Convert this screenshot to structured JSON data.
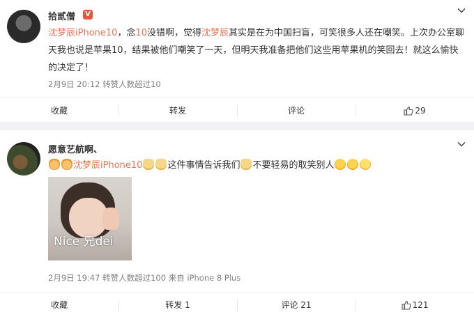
{
  "post1": {
    "username": "拾贰僧",
    "badge": "V",
    "text_parts": [
      {
        "t": "沈梦辰iPhone10",
        "link": true
      },
      {
        "t": "，念",
        "link": false
      },
      {
        "t": "10",
        "link": true
      },
      {
        "t": "没错啊，觉得",
        "link": false
      },
      {
        "t": "沈梦辰",
        "link": true
      },
      {
        "t": "其实是在为中国扫盲，可笑很多人还在嘲笑。上次办公室聊天我也说是苹果10，结果被他们嘲笑了一天，但明天我准备把他们这些用苹果机的笑回去！就这么愉快的决定了！",
        "link": false
      }
    ],
    "time": "2月9日 20:12",
    "stat": "转赞人数超过10",
    "actions": {
      "collect": "收藏",
      "repost": "转发",
      "comment": "评论",
      "like_count": "29"
    }
  },
  "post2": {
    "username": "愿意艺航啊、",
    "mention": "沈梦辰iPhone10",
    "text_a": "这件事情告诉我们",
    "text_b": "不要轻易的取笑别人",
    "image_caption": "Nice 兄dei",
    "time": "2月9日 19:47",
    "stat": "转赞人数超过100",
    "source": "来自 iPhone 8 Plus",
    "actions": {
      "collect": "收藏",
      "repost": "转发 1",
      "comment": "评论 21",
      "like_count": "121"
    }
  },
  "colors": {
    "link": "#eb7350",
    "badge": "#e8543c",
    "meta": "#808080",
    "background": "#f2f2f5"
  },
  "icons": [
    "chevron-down-icon",
    "thumbs-up-icon",
    "verified-badge-icon",
    "emoji-icon"
  ]
}
